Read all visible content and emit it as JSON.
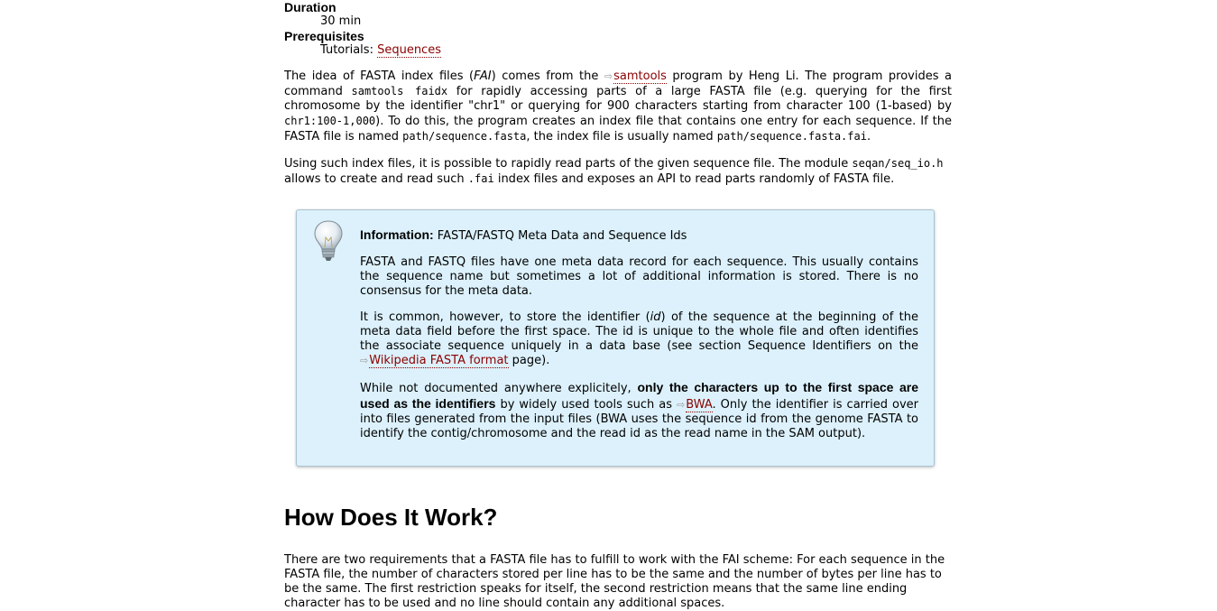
{
  "meta": {
    "duration_label": "Duration",
    "duration_value": "30 min",
    "prereq_label": "Prerequisites",
    "prereq_prefix": "Tutorials: ",
    "prereq_link": "Sequences"
  },
  "para1": {
    "t1": "The idea of FASTA index files (",
    "em1": "FAI",
    "t2": ") comes from the ",
    "link_arrow": "⇨",
    "link": "samtools",
    "t3": " program by Heng Li. The program provides a command ",
    "code1": "samtools faidx",
    "t4": " for rapidly accessing parts of a large FASTA file (e.g. querying for the first chromosome by the identifier \"chr1\" or querying for 900 characters starting from character 100 (1-based) by ",
    "code2": "chr1:100-1,000",
    "t5": "). To do this, the program creates an index file that contains one entry for each sequence. If the FASTA file is named ",
    "code3": "path/sequence.fasta",
    "t6": ", the index file is usually named ",
    "code4": "path/sequence.fasta.fai",
    "t7": "."
  },
  "para2": {
    "t1": "Using such index files, it is possible to rapidly read parts of the given sequence file. The module ",
    "code1": "seqan/seq_io.h",
    "t2": " allows to create and read such ",
    "code2": ".fai",
    "t3": " index files and exposes an API to read parts randomly of FASTA file."
  },
  "note": {
    "title_bold": "Information:",
    "title_rest": " FASTA/FASTQ Meta Data and Sequence Ids",
    "p1": "FASTA and FASTQ files have one meta data record for each sequence. This usually contains the sequence name but sometimes a lot of additional information is stored. There is no consensus for the meta data.",
    "p2_t1": "It is common, however, to store the identifier (",
    "p2_em": "id",
    "p2_t2": ") of the sequence at the beginning of the meta data field before the first space. The id is unique to the whole file and often identifies the associate sequence uniquely in a data base (see section Sequence Identifiers on the ",
    "p2_link": "Wikipedia FASTA format",
    "p2_t3": " page).",
    "p3_t1": "While not documented anywhere explicitely, ",
    "p3_bold": "only the characters up to the first space are used as the identifiers",
    "p3_t2": " by widely used tools such as ",
    "p3_link": "BWA",
    "p3_t3": ". Only the identifier is carried over into files generated from the input files (BWA uses the sequence id from the genome FASTA to identify the contig/chromosome and the read id as the read name in the SAM output)."
  },
  "section": {
    "heading": "How Does It Work?",
    "para": "There are two requirements that a FASTA file has to fulfill to work with the FAI scheme: For each sequence in the FASTA file, the number of characters stored per line has to be the same and the number of bytes per line has to be the same. The first restriction speaks for itself, the second restriction means that the same line ending character has to be used and no line should contain any additional spaces."
  },
  "icons": {
    "external_link": "external-link-arrow-icon",
    "note": "lightbulb-icon"
  },
  "colors": {
    "link": "#8b0000",
    "note_bg": "#dcf1fb",
    "note_border": "#a9c3d3"
  }
}
